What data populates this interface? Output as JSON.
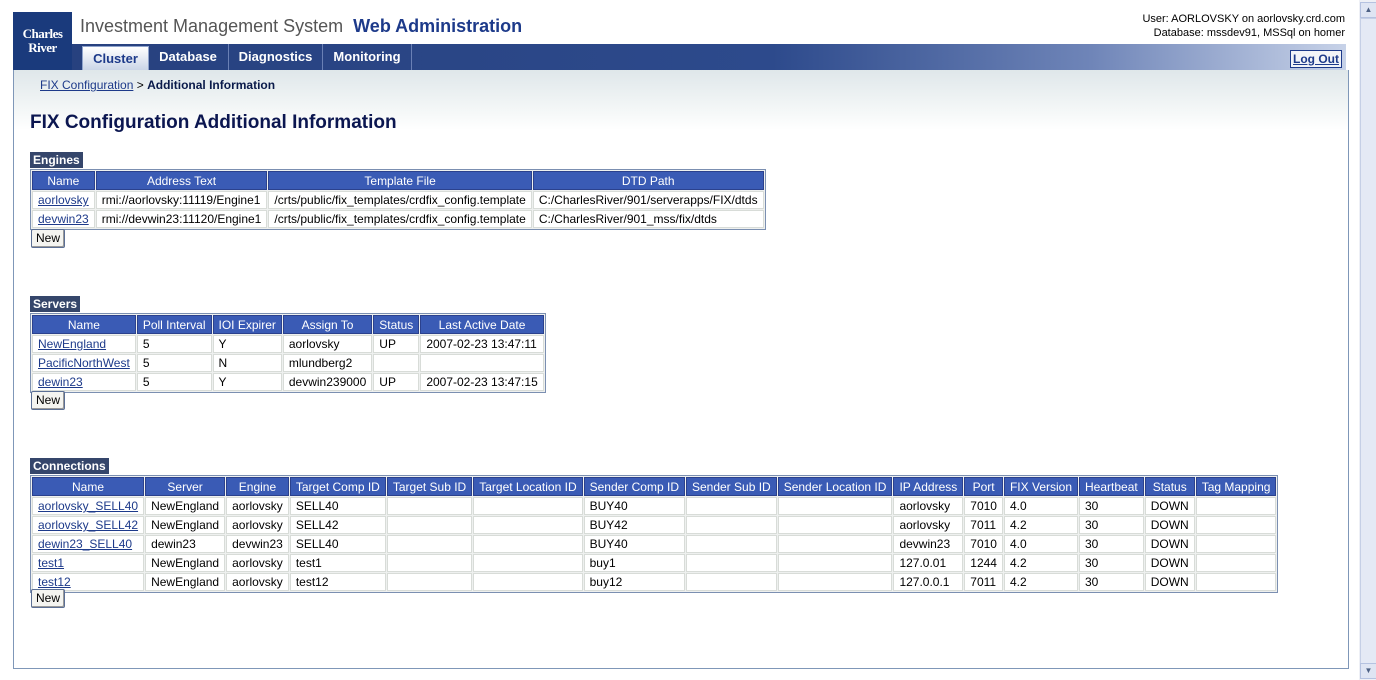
{
  "logo": {
    "line1": "Charles",
    "line2": "River"
  },
  "app": {
    "title": "Investment Management System",
    "subtitle": "Web Administration"
  },
  "user": {
    "line1": "User: AORLOVSKY on aorlovsky.crd.com",
    "line2": "Database: mssdev91, MSSql on homer"
  },
  "nav": {
    "tabs": [
      "Cluster",
      "Database",
      "Diagnostics",
      "Monitoring"
    ],
    "active": "Cluster",
    "logout": "Log Out"
  },
  "breadcrumb": {
    "parent": "FIX Configuration",
    "sep": ">",
    "current": "Additional Information"
  },
  "page_title": "FIX Configuration Additional Information",
  "engines": {
    "label": "Engines",
    "columns": [
      "Name",
      "Address Text",
      "Template File",
      "DTD Path"
    ],
    "rows": [
      [
        "aorlovsky",
        "rmi://aorlovsky:11119/Engine1",
        "/crts/public/fix_templates/crdfix_config.template",
        "C:/CharlesRiver/901/serverapps/FIX/dtds"
      ],
      [
        "devwin23",
        "rmi://devwin23:11120/Engine1",
        "/crts/public/fix_templates/crdfix_config.template",
        "C:/CharlesRiver/901_mss/fix/dtds"
      ]
    ],
    "new_label": "New"
  },
  "servers": {
    "label": "Servers",
    "columns": [
      "Name",
      "Poll Interval",
      "IOI Expirer",
      "Assign To",
      "Status",
      "Last Active Date"
    ],
    "rows": [
      [
        "NewEngland",
        "5",
        "Y",
        "aorlovsky",
        "UP",
        "2007-02-23 13:47:11"
      ],
      [
        "PacificNorthWest",
        "5",
        "N",
        "mlundberg2",
        "",
        ""
      ],
      [
        "dewin23",
        "5",
        "Y",
        "devwin239000",
        "UP",
        "2007-02-23 13:47:15"
      ]
    ],
    "new_label": "New"
  },
  "connections": {
    "label": "Connections",
    "columns": [
      "Name",
      "Server",
      "Engine",
      "Target Comp ID",
      "Target Sub ID",
      "Target Location ID",
      "Sender Comp ID",
      "Sender Sub ID",
      "Sender Location ID",
      "IP Address",
      "Port",
      "FIX Version",
      "Heartbeat",
      "Status",
      "Tag Mapping"
    ],
    "rows": [
      [
        "aorlovsky_SELL40",
        "NewEngland",
        "aorlovsky",
        "SELL40",
        "",
        "",
        "BUY40",
        "",
        "",
        "aorlovsky",
        "7010",
        "4.0",
        "30",
        "DOWN",
        ""
      ],
      [
        "aorlovsky_SELL42",
        "NewEngland",
        "aorlovsky",
        "SELL42",
        "",
        "",
        "BUY42",
        "",
        "",
        "aorlovsky",
        "7011",
        "4.2",
        "30",
        "DOWN",
        ""
      ],
      [
        "dewin23_SELL40",
        "dewin23",
        "devwin23",
        "SELL40",
        "",
        "",
        "BUY40",
        "",
        "",
        "devwin23",
        "7010",
        "4.0",
        "30",
        "DOWN",
        ""
      ],
      [
        "test1",
        "NewEngland",
        "aorlovsky",
        "test1",
        "",
        "",
        "buy1",
        "",
        "",
        "127.0.01",
        "1244",
        "4.2",
        "30",
        "DOWN",
        ""
      ],
      [
        "test12",
        "NewEngland",
        "aorlovsky",
        "test12",
        "",
        "",
        "buy12",
        "",
        "",
        "127.0.0.1",
        "7011",
        "4.2",
        "30",
        "DOWN",
        ""
      ]
    ],
    "new_label": "New"
  }
}
